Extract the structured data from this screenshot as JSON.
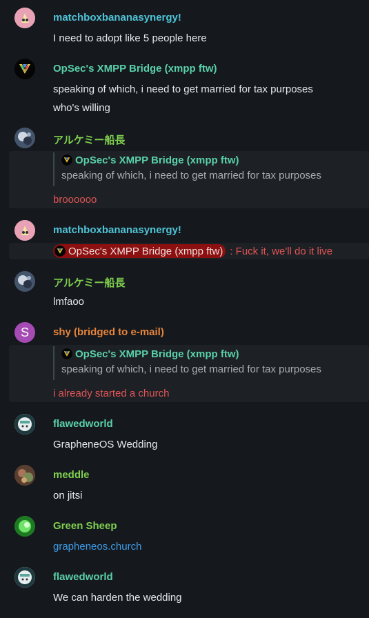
{
  "colors": {
    "background": "#15191e",
    "name_cyan": "#4fc3d6",
    "name_teal": "#5ad0a8",
    "name_green": "#7fcf4e",
    "name_orange": "#e8843a",
    "red_text": "#e05454",
    "link": "#3f9be6"
  },
  "messages": [
    {
      "sender": "matchboxbananasynergy!",
      "lines": [
        "I need to adopt like 5 people here"
      ]
    },
    {
      "sender": "OpSec's XMPP Bridge (xmpp ftw)",
      "lines": [
        "speaking of which, i need to get married for tax purposes",
        "who's willing"
      ]
    },
    {
      "sender": "アルケミー船長",
      "quote": {
        "sender": "OpSec's XMPP Bridge (xmpp ftw)",
        "text": "speaking of which, i need to get married for tax purposes"
      },
      "lines": [
        "broooooo"
      ]
    },
    {
      "sender": "matchboxbananasynergy!",
      "mention": "OpSec's XMPP Bridge (xmpp ftw)",
      "lines": [
        ": Fuck it, we'll do it live"
      ]
    },
    {
      "sender": "アルケミー船長",
      "lines": [
        "lmfaoo"
      ]
    },
    {
      "sender": "shy (bridged to e-mail)",
      "avatar_letter": "S",
      "quote": {
        "sender": "OpSec's XMPP Bridge (xmpp ftw)",
        "text": "speaking of which, i need to get married for tax purposes"
      },
      "lines": [
        "i already started a church"
      ]
    },
    {
      "sender": "flawedworld",
      "lines": [
        "GrapheneOS Wedding"
      ]
    },
    {
      "sender": "meddle",
      "lines": [
        "on jitsi"
      ]
    },
    {
      "sender": "Green Sheep",
      "lines": [
        "grapheneos.church"
      ]
    },
    {
      "sender": "flawedworld",
      "lines": [
        "We can harden the wedding"
      ]
    }
  ]
}
